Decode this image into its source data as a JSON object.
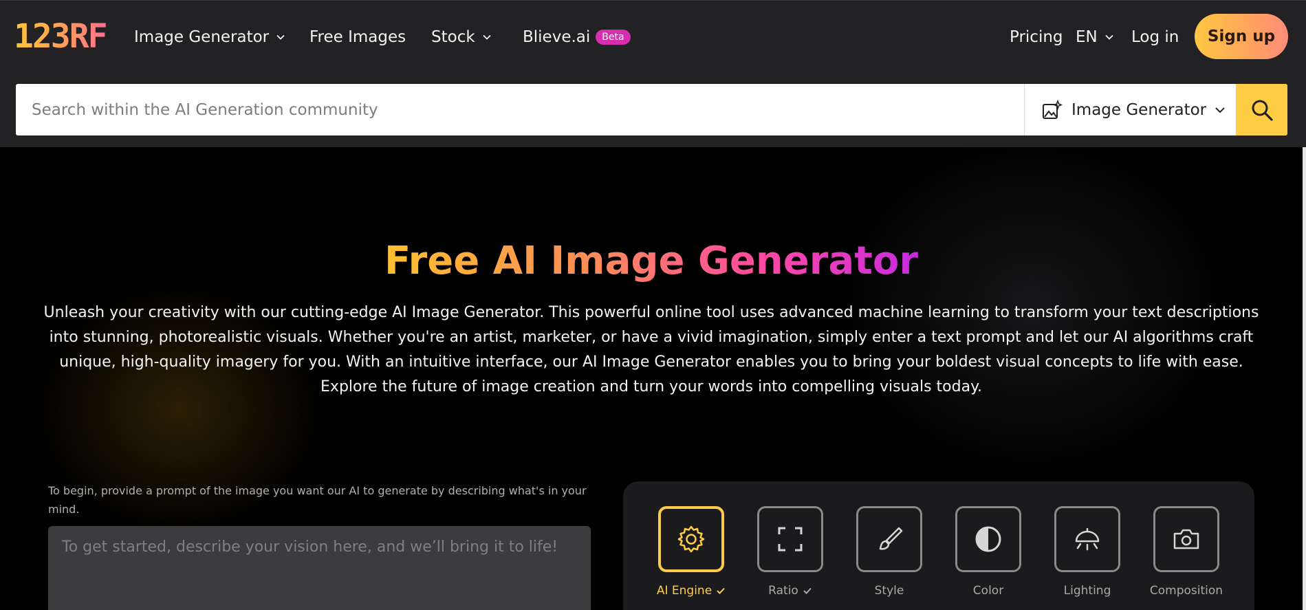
{
  "nav": {
    "logo": "123RF",
    "items": [
      {
        "label": "Image Generator",
        "has_dropdown": true
      },
      {
        "label": "Free Images",
        "has_dropdown": false
      },
      {
        "label": "Stock",
        "has_dropdown": true
      },
      {
        "label": "Blieve.ai",
        "badge": "Beta"
      }
    ],
    "pricing": "Pricing",
    "language": "EN",
    "login": "Log in",
    "signup": "Sign up"
  },
  "search": {
    "placeholder": "Search within the AI Generation community",
    "type_label": "Image Generator",
    "icon": "search-icon"
  },
  "hero": {
    "title": "Free AI Image Generator",
    "description": "Unleash your creativity with our cutting-edge AI Image Generator. This powerful online tool uses advanced machine learning to transform your text descriptions into stunning, photorealistic visuals. Whether you're an artist, marketer, or have a vivid imagination, simply enter a text prompt and let our AI algorithms craft unique, high-quality imagery for you. With an intuitive interface, our AI Image Generator enables you to bring your boldest visual concepts to life with ease. Explore the future of image creation and turn your words into compelling visuals today."
  },
  "prompt": {
    "hint": "To begin, provide a prompt of the image you want our AI to generate by describing what's in your mind.",
    "placeholder": "To get started, describe your vision here, and we’ll bring it to life!"
  },
  "options": [
    {
      "label": "AI Engine",
      "icon": "gear-icon",
      "active": true,
      "checked": true
    },
    {
      "label": "Ratio",
      "icon": "expand-icon",
      "active": false,
      "checked": true
    },
    {
      "label": "Style",
      "icon": "brush-icon",
      "active": false,
      "checked": false
    },
    {
      "label": "Color",
      "icon": "contrast-icon",
      "active": false,
      "checked": false
    },
    {
      "label": "Lighting",
      "icon": "lamp-icon",
      "active": false,
      "checked": false
    },
    {
      "label": "Composition",
      "icon": "camera-icon",
      "active": false,
      "checked": false
    }
  ],
  "colors": {
    "accent": "#ffcd45",
    "topbar": "#222225",
    "beta_badge": "#d52fb0"
  }
}
